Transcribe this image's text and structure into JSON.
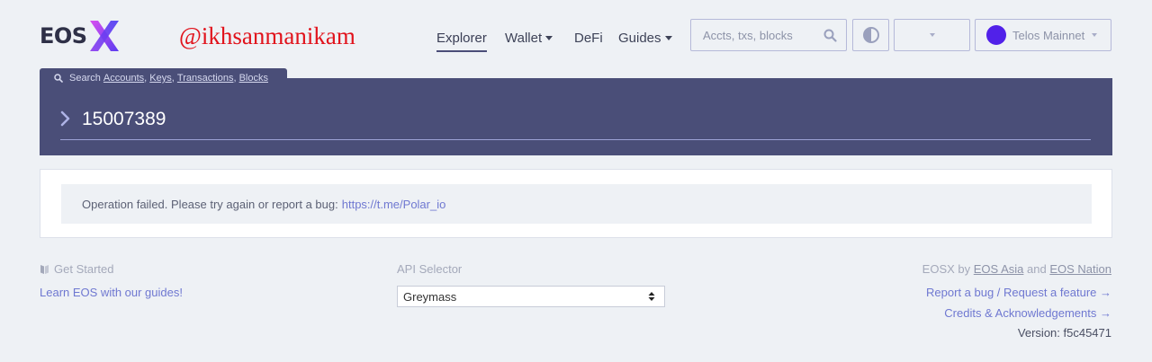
{
  "header": {
    "logo_text": "EOS",
    "watermark": "@ikhsanmanikam",
    "nav": [
      {
        "label": "Explorer",
        "active": true
      },
      {
        "label": "Wallet",
        "dropdown": true
      },
      {
        "label": "DeFi"
      },
      {
        "label": "Guides",
        "dropdown": true
      }
    ],
    "search_placeholder": "Accts, txs, blocks",
    "network_label": "Telos Mainnet",
    "network_color": "#5121e9"
  },
  "hero": {
    "search_prefix": "Search",
    "search_links": [
      "Accounts",
      "Keys",
      "Transactions",
      "Blocks"
    ],
    "query": "15007389"
  },
  "alert": {
    "message": "Operation failed. Please try again or report a bug:",
    "link": "https://t.me/Polar_io"
  },
  "footer": {
    "get_started": "Get Started",
    "learn_link": "Learn EOS with our guides!",
    "api_label": "API Selector",
    "api_selected": "Greymass",
    "credit_prefix": "EOSX by",
    "credit_link1": "EOS Asia",
    "credit_and": "and",
    "credit_link2": "EOS Nation",
    "report_link": "Report a bug / Request a feature →",
    "credits_link": "Credits & Acknowledgements →",
    "version": "Version: f5c45471"
  },
  "colors": {
    "accent": "#4a4e78",
    "link": "#6f78d1",
    "background": "#eef1f5"
  }
}
